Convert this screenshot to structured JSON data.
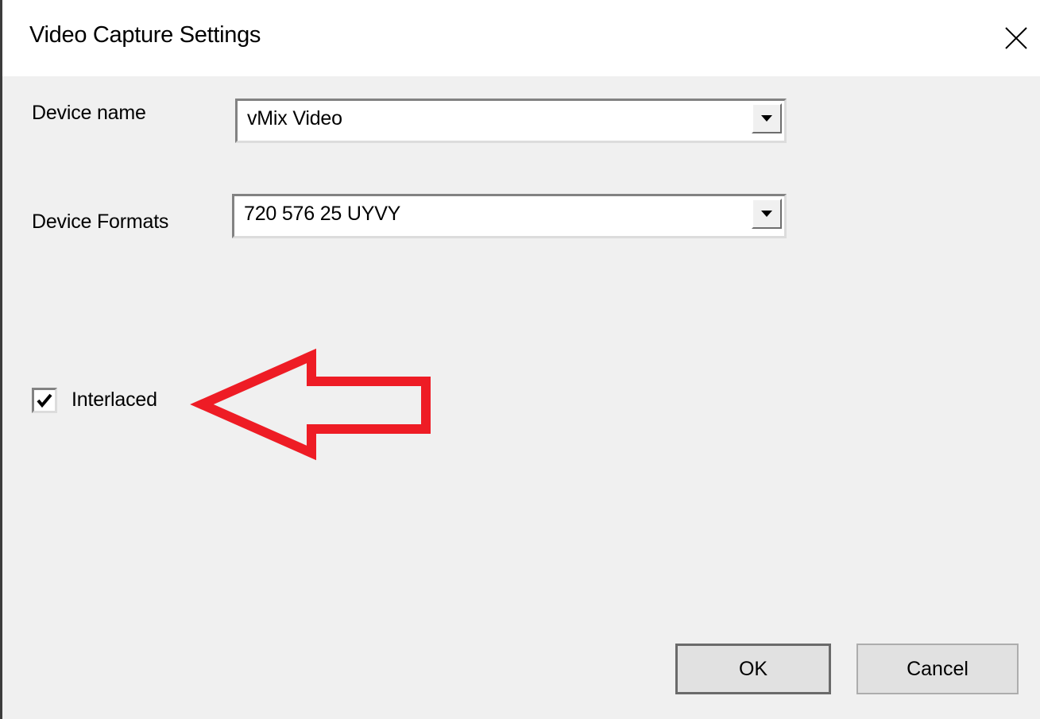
{
  "dialog": {
    "title": "Video Capture Settings",
    "close_icon": "close-icon"
  },
  "fields": {
    "device_name_label": "Device name",
    "device_name_value": "vMix Video",
    "device_formats_label": "Device Formats",
    "device_formats_value": "720 576 25 UYVY"
  },
  "options": {
    "interlaced_label": "Interlaced",
    "interlaced_checked": true
  },
  "buttons": {
    "ok_label": "OK",
    "cancel_label": "Cancel"
  },
  "annotation": {
    "arrow_color": "#ee1c25",
    "arrow_icon": "red-left-arrow-icon"
  }
}
